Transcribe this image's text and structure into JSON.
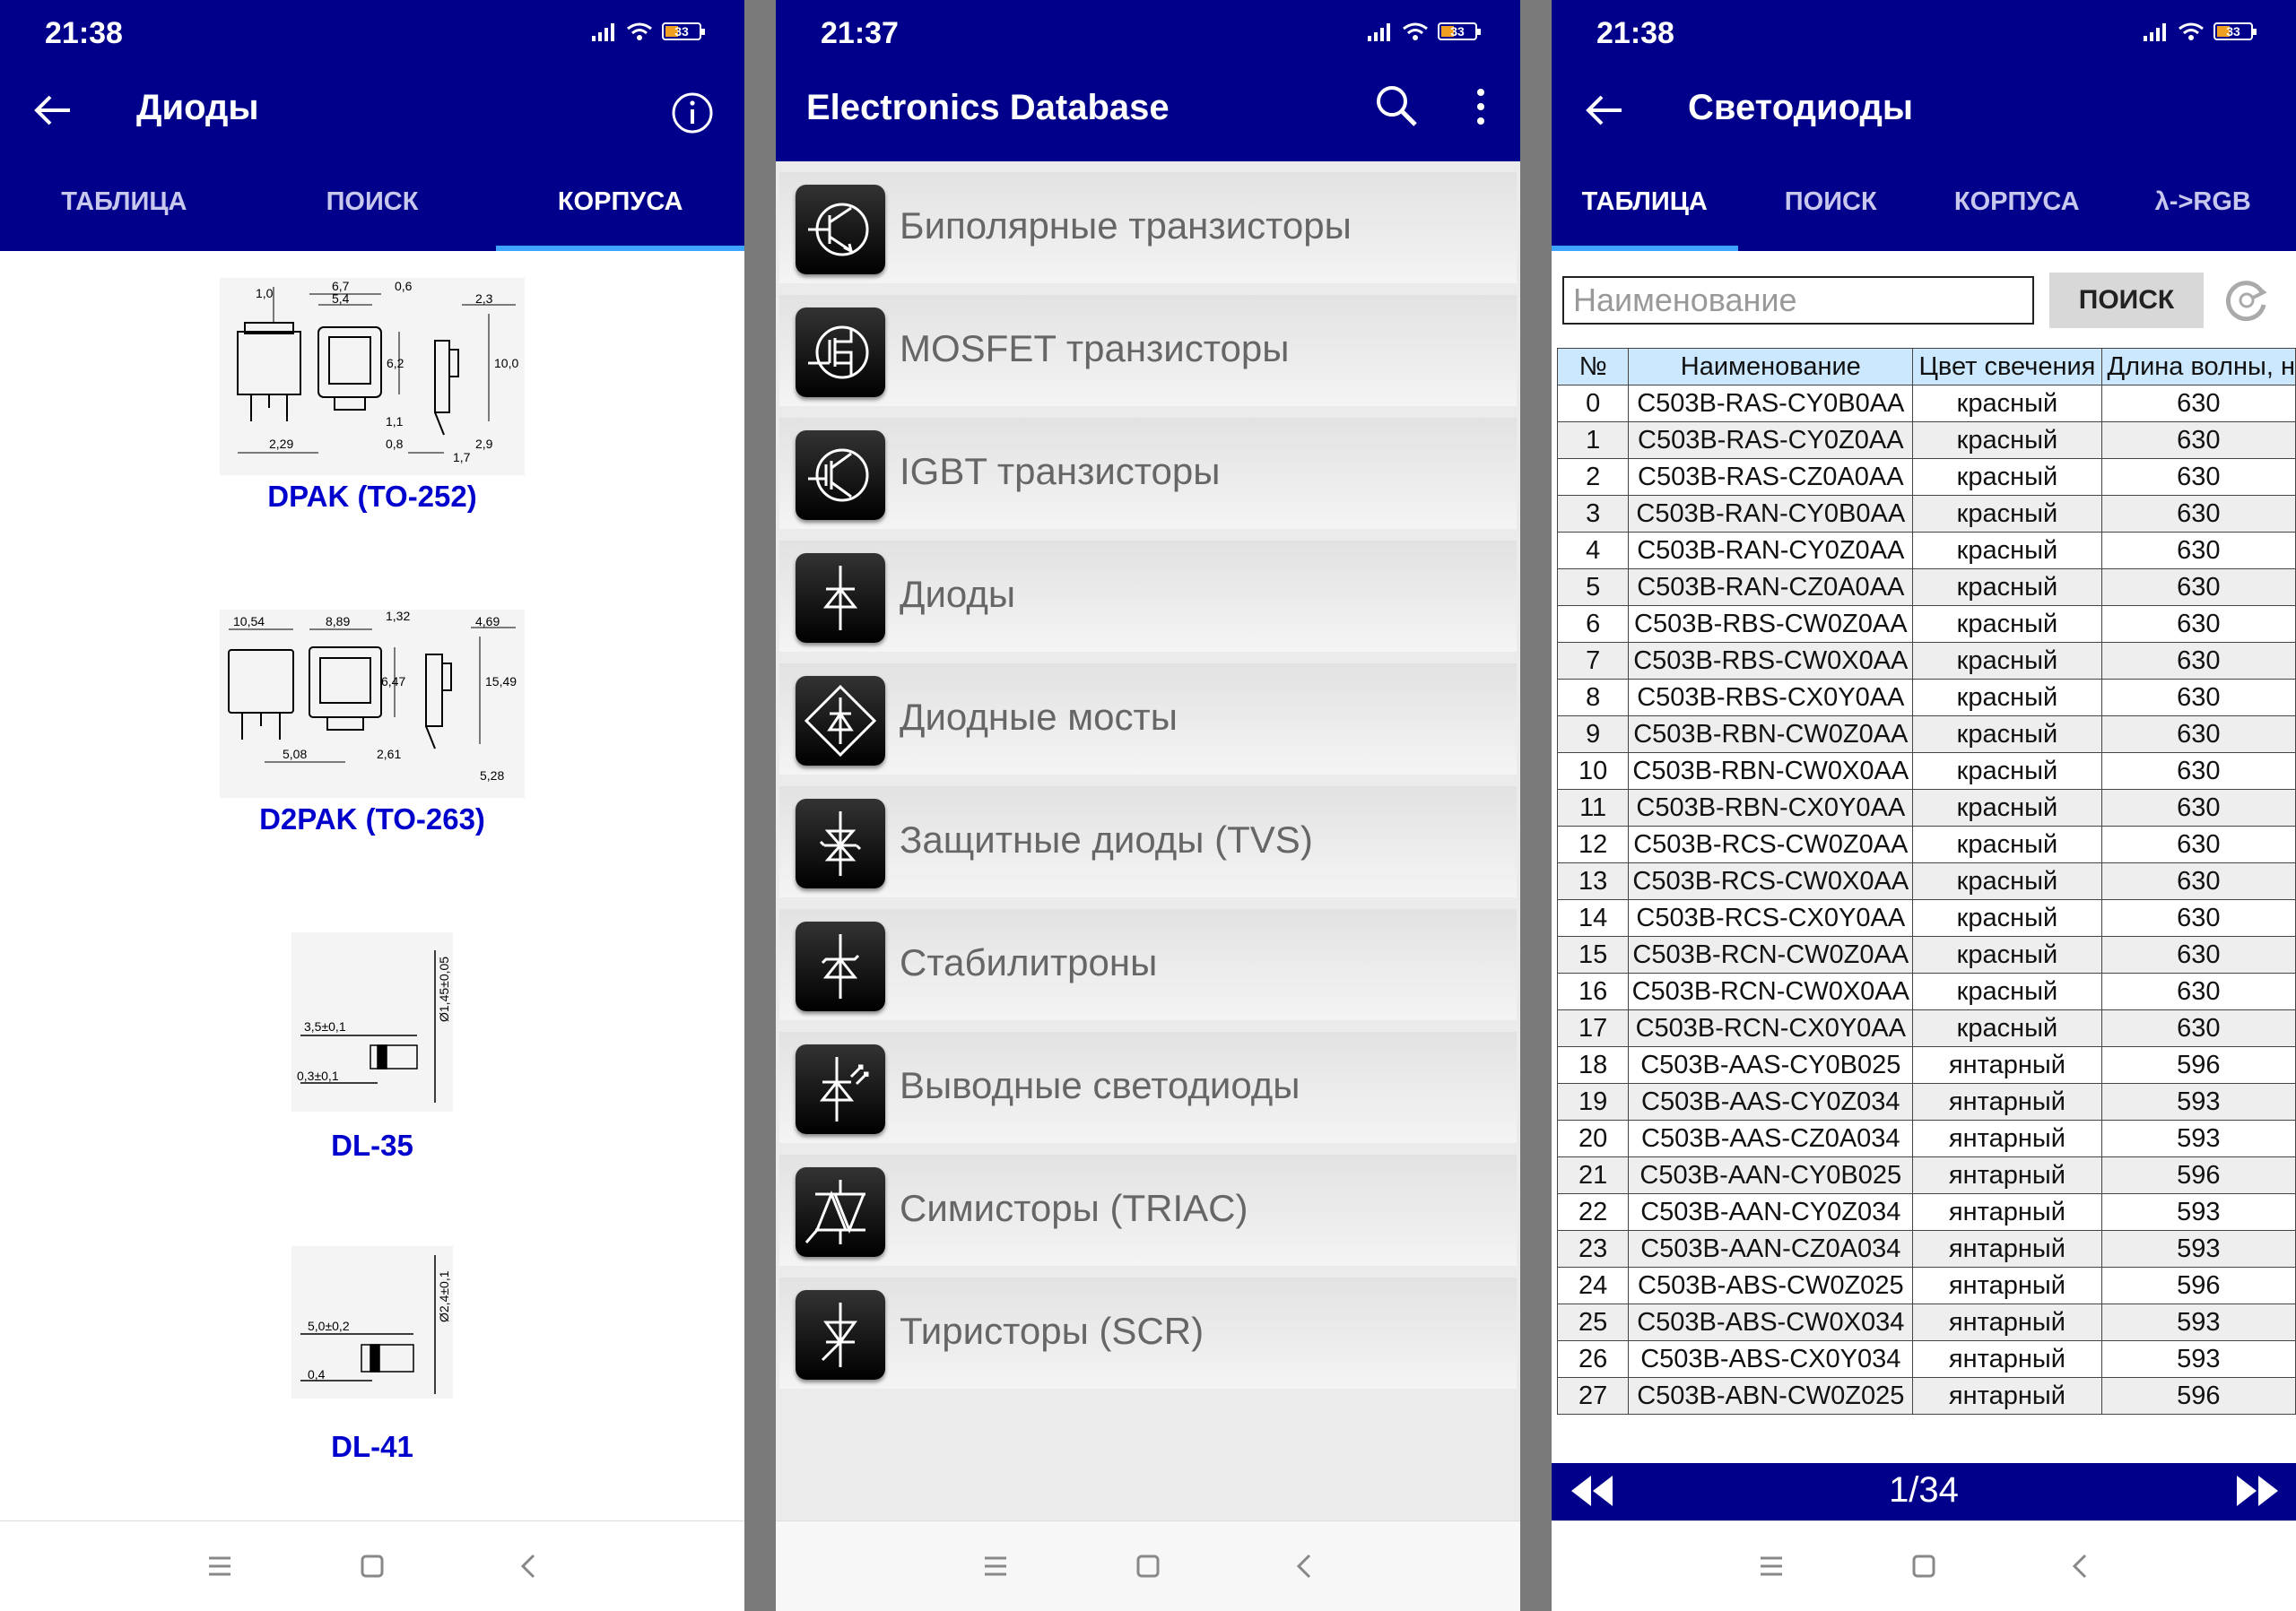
{
  "panels": {
    "diodes": {
      "time": "21:38",
      "battery": "33",
      "title": "Диоды",
      "tabs": [
        "ТАБЛИЦА",
        "ПОИСК",
        "КОРПУСА"
      ],
      "packages": [
        {
          "name": "DPAK (TO-252)",
          "dims": [
            "1,0",
            "6,7",
            "5,4",
            "0,6",
            "2,3",
            "6,2",
            "10,0",
            "2,29",
            "1,1",
            "0,8",
            "1,7",
            "2,9"
          ]
        },
        {
          "name": "D2PAK (TO-263)",
          "dims": [
            "10,54",
            "8,89",
            "1,32",
            "4,69",
            "6,47",
            "15,49",
            "5,08",
            "2,61",
            "5,28"
          ]
        },
        {
          "name": "DL-35",
          "dims": [
            "Ø1,45±0,05",
            "3,5±0,1",
            "0,3±0,1"
          ]
        },
        {
          "name": "DL-41",
          "dims": [
            "Ø2,4±0,1",
            "5,0±0,2",
            "0,4"
          ]
        }
      ]
    },
    "main": {
      "time": "21:37",
      "battery": "33",
      "title": "Electronics Database",
      "menu": [
        {
          "label": "Биполярные транзисторы",
          "icon": "bipolar-transistor-icon"
        },
        {
          "label": "MOSFET транзисторы",
          "icon": "mosfet-icon"
        },
        {
          "label": "IGBT транзисторы",
          "icon": "igbt-icon"
        },
        {
          "label": "Диоды",
          "icon": "diode-icon"
        },
        {
          "label": "Диодные мосты",
          "icon": "diode-bridge-icon"
        },
        {
          "label": "Защитные диоды (TVS)",
          "icon": "tvs-diode-icon"
        },
        {
          "label": "Стабилитроны",
          "icon": "zener-icon"
        },
        {
          "label": "Выводные светодиоды",
          "icon": "led-icon"
        },
        {
          "label": "Симисторы (TRIAC)",
          "icon": "triac-icon"
        },
        {
          "label": "Тиристоры (SCR)",
          "icon": "scr-icon"
        }
      ]
    },
    "leds": {
      "time": "21:38",
      "battery": "33",
      "title": "Светодиоды",
      "tabs": [
        "ТАБЛИЦА",
        "ПОИСК",
        "КОРПУСА",
        "λ->RGB"
      ],
      "search_placeholder": "Наименование",
      "search_button": "ПОИСК",
      "columns": [
        "№",
        "Наименование",
        "Цвет свечения",
        "Длина волны, н"
      ],
      "rows": [
        [
          "0",
          "C503B-RAS-CY0B0AA",
          "красный",
          "630"
        ],
        [
          "1",
          "C503B-RAS-CY0Z0AA",
          "красный",
          "630"
        ],
        [
          "2",
          "C503B-RAS-CZ0A0AA",
          "красный",
          "630"
        ],
        [
          "3",
          "C503B-RAN-CY0B0AA",
          "красный",
          "630"
        ],
        [
          "4",
          "C503B-RAN-CY0Z0AA",
          "красный",
          "630"
        ],
        [
          "5",
          "C503B-RAN-CZ0A0AA",
          "красный",
          "630"
        ],
        [
          "6",
          "C503B-RBS-CW0Z0AA",
          "красный",
          "630"
        ],
        [
          "7",
          "C503B-RBS-CW0X0AA",
          "красный",
          "630"
        ],
        [
          "8",
          "C503B-RBS-CX0Y0AA",
          "красный",
          "630"
        ],
        [
          "9",
          "C503B-RBN-CW0Z0AA",
          "красный",
          "630"
        ],
        [
          "10",
          "C503B-RBN-CW0X0AA",
          "красный",
          "630"
        ],
        [
          "11",
          "C503B-RBN-CX0Y0AA",
          "красный",
          "630"
        ],
        [
          "12",
          "C503B-RCS-CW0Z0AA",
          "красный",
          "630"
        ],
        [
          "13",
          "C503B-RCS-CW0X0AA",
          "красный",
          "630"
        ],
        [
          "14",
          "C503B-RCS-CX0Y0AA",
          "красный",
          "630"
        ],
        [
          "15",
          "C503B-RCN-CW0Z0AA",
          "красный",
          "630"
        ],
        [
          "16",
          "C503B-RCN-CW0X0AA",
          "красный",
          "630"
        ],
        [
          "17",
          "C503B-RCN-CX0Y0AA",
          "красный",
          "630"
        ],
        [
          "18",
          "C503B-AAS-CY0B025",
          "янтарный",
          "596"
        ],
        [
          "19",
          "C503B-AAS-CY0Z034",
          "янтарный",
          "593"
        ],
        [
          "20",
          "C503B-AAS-CZ0A034",
          "янтарный",
          "593"
        ],
        [
          "21",
          "C503B-AAN-CY0B025",
          "янтарный",
          "596"
        ],
        [
          "22",
          "C503B-AAN-CY0Z034",
          "янтарный",
          "593"
        ],
        [
          "23",
          "C503B-AAN-CZ0A034",
          "янтарный",
          "593"
        ],
        [
          "24",
          "C503B-ABS-CW0Z025",
          "янтарный",
          "596"
        ],
        [
          "25",
          "C503B-ABS-CW0X034",
          "янтарный",
          "593"
        ],
        [
          "26",
          "C503B-ABS-CX0Y034",
          "янтарный",
          "593"
        ],
        [
          "27",
          "C503B-ABN-CW0Z025",
          "янтарный",
          "596"
        ]
      ],
      "page": "1/34"
    }
  },
  "colors": {
    "appbar": "#00008b",
    "tab_indicator": "#3da3ff",
    "package_label": "#0000cd",
    "header_row": "#cce8ff"
  }
}
